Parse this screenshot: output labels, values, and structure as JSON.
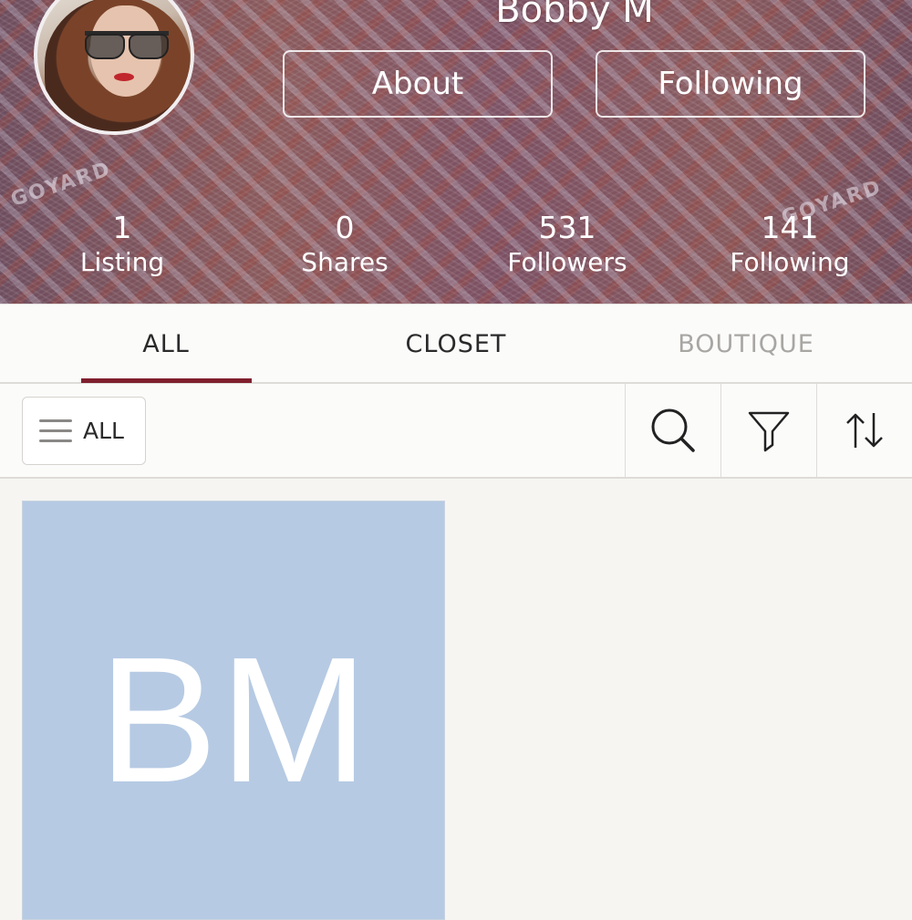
{
  "profile": {
    "username": "Bobby M",
    "about_label": "About",
    "following_label": "Following",
    "watermark_text": "GOYARD"
  },
  "stats": [
    {
      "value": "1",
      "label": "Listing"
    },
    {
      "value": "0",
      "label": "Shares"
    },
    {
      "value": "531",
      "label": "Followers"
    },
    {
      "value": "141",
      "label": "Following"
    }
  ],
  "tabs": {
    "all": "ALL",
    "closet": "CLOSET",
    "boutique": "BOUTIQUE"
  },
  "toolbar": {
    "filter_label": "ALL",
    "icons": [
      "hamburger-icon",
      "search-icon",
      "filter-icon",
      "sort-icon"
    ]
  },
  "listings": [
    {
      "monogram": "BM"
    }
  ],
  "colors": {
    "accent": "#7f1f2e",
    "tab_inactive": "#a8a6a3",
    "listing_bg": "#b6cae3",
    "page_bg": "#f6f5f2"
  }
}
